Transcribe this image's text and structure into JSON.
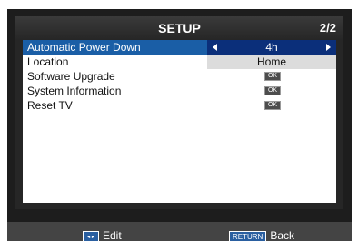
{
  "header": {
    "title": "SETUP",
    "page": "2/2"
  },
  "rows": [
    {
      "label": "Automatic Power Down",
      "value": "4h"
    },
    {
      "label": "Location",
      "value": "Home"
    },
    {
      "label": "Software Upgrade",
      "button": "OK"
    },
    {
      "label": "System Information",
      "button": "OK"
    },
    {
      "label": "Reset TV",
      "button": "OK"
    }
  ],
  "footer": {
    "edit_label": "Edit",
    "edit_icon": "◂ ▸",
    "back_key": "RETURN",
    "back_label": "Back"
  },
  "colors": {
    "selected_row": "#1a5ea6",
    "selected_value": "#0b2f7a",
    "value_box": "#dcdcdc",
    "ok_button": "#4d4d4d"
  }
}
